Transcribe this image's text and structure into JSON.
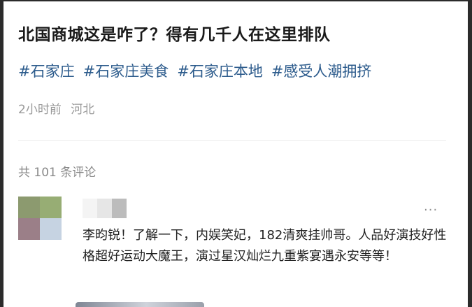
{
  "post": {
    "title": "北国商城这是咋了？得有几千人在这里排队",
    "tags": [
      "#石家庄",
      "#石家庄美食",
      "#石家庄本地",
      "#感受人潮拥挤"
    ],
    "time": "2小时前",
    "location": "河北"
  },
  "comments_section": {
    "count_label": "共 101 条评论"
  },
  "comment": {
    "more_icon": "more-horizontal-icon",
    "text": "李昀锐！了解一下，内娱笑妃，182清爽挂帅哥。人品好演技好性格超好运动大魔王，演过星汉灿烂九重紫宴遇永安等等！"
  },
  "colors": {
    "tag": "#2c5b8c",
    "meta": "#999999",
    "frame": "#2b2b2b"
  }
}
